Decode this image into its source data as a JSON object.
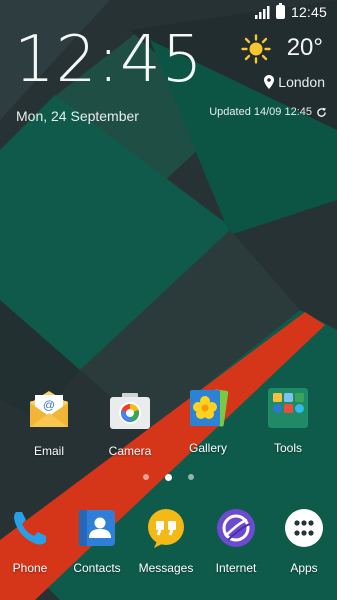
{
  "status_bar": {
    "time": "12:45"
  },
  "clock_widget": {
    "time": "12:45",
    "date": "Mon, 24 September",
    "temperature": "20°",
    "location": "London",
    "updated": "Updated 14/09 12:45"
  },
  "home_apps": [
    {
      "label": "Email",
      "icon": "email-icon"
    },
    {
      "label": "Camera",
      "icon": "camera-icon"
    },
    {
      "label": "Gallery",
      "icon": "gallery-icon"
    },
    {
      "label": "Tools",
      "icon": "tools-folder-icon"
    }
  ],
  "page_indicator": {
    "pages": 3,
    "current": 2
  },
  "dock_apps": [
    {
      "label": "Phone",
      "icon": "phone-icon"
    },
    {
      "label": "Contacts",
      "icon": "contacts-icon"
    },
    {
      "label": "Messages",
      "icon": "messages-icon"
    },
    {
      "label": "Internet",
      "icon": "internet-icon"
    },
    {
      "label": "Apps",
      "icon": "apps-grid-icon"
    }
  ],
  "colors": {
    "wallpaper_dark": "#263234",
    "wallpaper_teal": "#0e5b4c",
    "wallpaper_stripe": "#d5361a",
    "accent_blue": "#1e88e5"
  }
}
